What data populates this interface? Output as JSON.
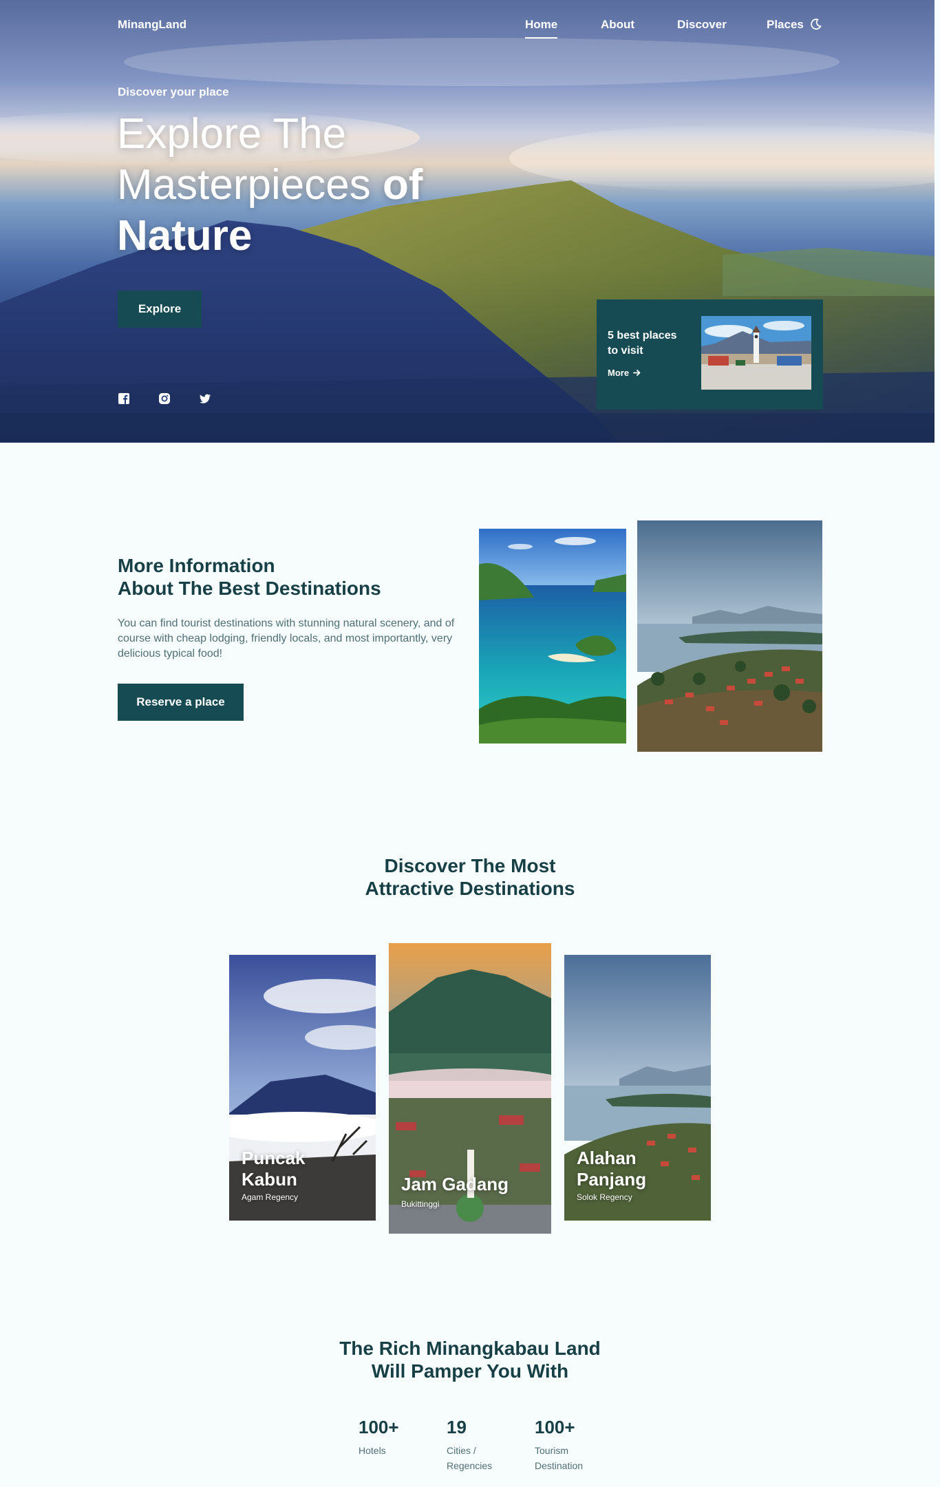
{
  "nav": {
    "logo": "MinangLand",
    "links": [
      "Home",
      "About",
      "Discover",
      "Places"
    ],
    "theme_icon": "moon-icon"
  },
  "hero": {
    "subtitle": "Discover your place",
    "title_line1": "Explore The",
    "title_line2a": "Masterpieces ",
    "title_line2b": "of",
    "title_line3": "Nature",
    "explore_label": "Explore",
    "socials": [
      "facebook-icon",
      "instagram-icon",
      "twitter-icon"
    ],
    "card": {
      "title": "5 best places to visit",
      "more_label": "More"
    }
  },
  "info": {
    "title_line1": "More Information",
    "title_line2": "About The Best Destinations",
    "description": "You can find tourist destinations with stunning natural scenery, and of course with cheap lodging, friendly locals, and most importantly, very delicious typical food!",
    "button_label": "Reserve a place"
  },
  "discover": {
    "title_line1": "Discover The Most",
    "title_line2": "Attractive Destinations",
    "cards": [
      {
        "name_line1": "Puncak",
        "name_line2": "Kabun",
        "region": "Agam Regency"
      },
      {
        "name_line1": "Jam Gadang",
        "region": "Bukittinggi"
      },
      {
        "name_line1": "Alahan",
        "name_line2": "Panjang",
        "region": "Solok Regency"
      }
    ]
  },
  "stats": {
    "title_line1": "The Rich Minangkabau Land",
    "title_line2": "Will Pamper You With",
    "items": [
      {
        "value": "100+",
        "label_line1": "Hotels",
        "label_line2": ""
      },
      {
        "value": "19",
        "label_line1": "Cities /",
        "label_line2": "Regencies"
      },
      {
        "value": "100+",
        "label_line1": "Tourism",
        "label_line2": "Destination"
      }
    ]
  },
  "colors": {
    "primary": "#174b53",
    "heading": "#173f46",
    "body_text": "#4f6f74",
    "background": "#f7fcfc"
  }
}
